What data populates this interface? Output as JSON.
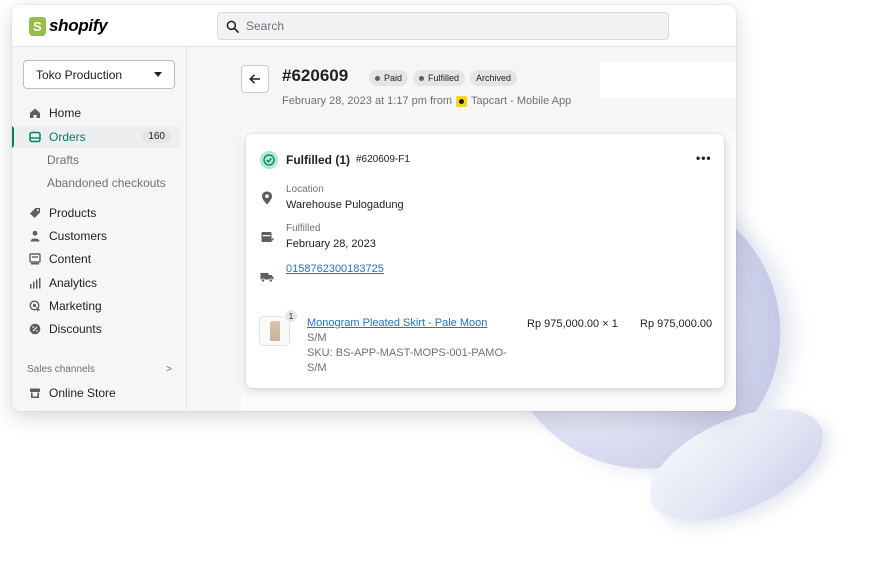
{
  "brand": {
    "name": "shopify"
  },
  "search": {
    "placeholder": "Search"
  },
  "sidebar": {
    "store": "Toko Production",
    "items": [
      {
        "label": "Home",
        "icon": "home-icon"
      },
      {
        "label": "Orders",
        "icon": "orders-icon",
        "count": "160"
      },
      {
        "label": "Drafts"
      },
      {
        "label": "Abandoned checkouts"
      },
      {
        "label": "Products",
        "icon": "tag-icon"
      },
      {
        "label": "Customers",
        "icon": "person-icon"
      },
      {
        "label": "Content",
        "icon": "content-icon"
      },
      {
        "label": "Analytics",
        "icon": "analytics-icon"
      },
      {
        "label": "Marketing",
        "icon": "marketing-icon"
      },
      {
        "label": "Discounts",
        "icon": "discount-icon"
      }
    ],
    "sales_channels": {
      "label": "Sales channels",
      "chevron": ">"
    },
    "online_store": {
      "label": "Online Store",
      "icon": "store-icon"
    }
  },
  "order": {
    "number": "#620609",
    "badges": [
      "Paid",
      "Fulfilled",
      "Archived"
    ],
    "date_prefix": "February 28, 2023 at 1:17 pm from",
    "source": "Tapcart - Mobile App"
  },
  "fulfillment": {
    "title": "Fulfilled (1)",
    "id": "#620609-F1",
    "more": "•••",
    "location_label": "Location",
    "location_value": "Warehouse Pulogadung",
    "fulfilled_label": "Fulfilled",
    "fulfilled_date": "February 28, 2023",
    "tracking": "0158762300183725",
    "item": {
      "qty_badge": "1",
      "name": "Monogram Pleated Skirt - Pale Moon",
      "variant": "S/M",
      "sku_line1": "SKU: BS-APP-MAST-MOPS-001-PAMO-",
      "sku_line2": "S/M",
      "unit_price": "Rp 975,000.00 × 1",
      "total": "Rp 975,000.00"
    }
  },
  "colors": {
    "accent": "#008060",
    "link": "#2c6ecb",
    "success_bg": "#aee9d1"
  }
}
